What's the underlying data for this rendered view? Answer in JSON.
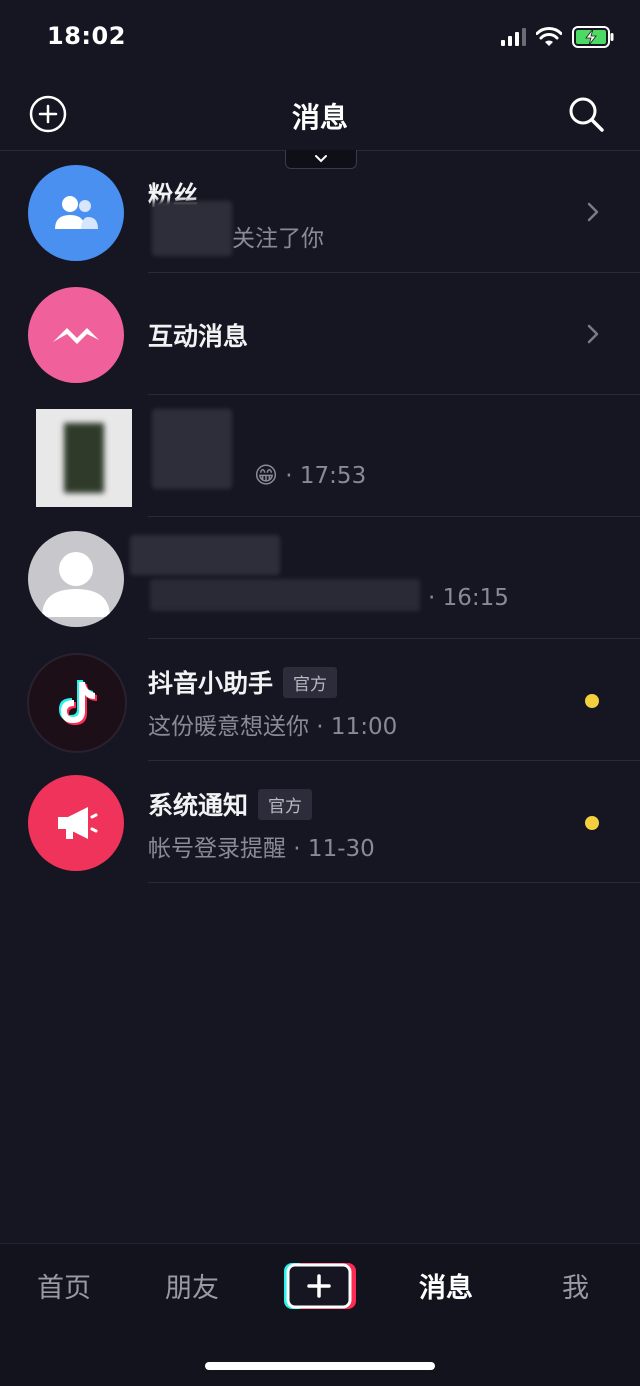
{
  "status_bar": {
    "time": "18:02"
  },
  "header": {
    "title": "消息"
  },
  "messages": [
    {
      "title": "粉丝",
      "subtitle": "关注了你",
      "trailing": "chevron-right"
    },
    {
      "title": "互动消息",
      "subtitle": "",
      "trailing": "chevron-right"
    },
    {
      "title": "",
      "subtitle": "· 17:53",
      "emoji": "😁"
    },
    {
      "title": "",
      "subtitle": "· 16:15"
    },
    {
      "title": "抖音小助手",
      "badge": "官方",
      "subtitle": "这份暖意想送你 · 11:00",
      "unread": true
    },
    {
      "title": "系统通知",
      "badge": "官方",
      "subtitle": "帐号登录提醒 · 11-30",
      "unread": true
    }
  ],
  "tabs": [
    {
      "label": "首页"
    },
    {
      "label": "朋友"
    },
    {
      "label": "消息",
      "active": true
    },
    {
      "label": "我"
    }
  ],
  "colors": {
    "background": "#161622",
    "fans_avatar": "#4a90f0",
    "interact_avatar": "#f0609a",
    "system_avatar": "#f0335a",
    "unread_dot": "#f4d03f"
  }
}
